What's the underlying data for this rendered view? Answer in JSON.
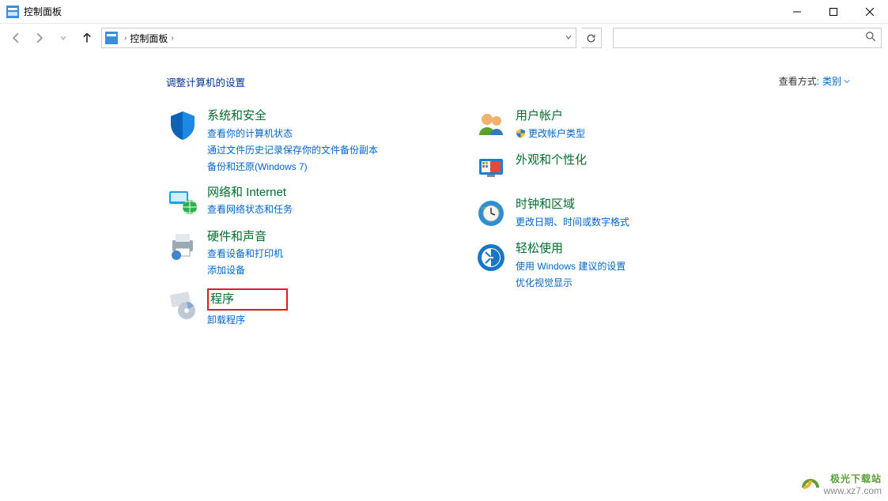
{
  "window": {
    "title": "控制面板"
  },
  "breadcrumb": {
    "root": "控制面板"
  },
  "heading": "调整计算机的设置",
  "viewBy": {
    "label": "查看方式:",
    "value": "类别"
  },
  "categories": {
    "systemSecurity": {
      "title": "系统和安全",
      "links": [
        "查看你的计算机状态",
        "通过文件历史记录保存你的文件备份副本",
        "备份和还原(Windows 7)"
      ]
    },
    "network": {
      "title": "网络和 Internet",
      "links": [
        "查看网络状态和任务"
      ]
    },
    "hardware": {
      "title": "硬件和声音",
      "links": [
        "查看设备和打印机",
        "添加设备"
      ]
    },
    "programs": {
      "title": "程序",
      "links": [
        "卸载程序"
      ]
    },
    "userAccounts": {
      "title": "用户帐户",
      "links": [
        "更改帐户类型"
      ]
    },
    "appearance": {
      "title": "外观和个性化"
    },
    "clock": {
      "title": "时钟和区域",
      "links": [
        "更改日期、时间或数字格式"
      ]
    },
    "ease": {
      "title": "轻松使用",
      "links": [
        "使用 Windows 建议的设置",
        "优化视觉显示"
      ]
    }
  },
  "watermark": {
    "line1": "极光下载站",
    "line2": "www.xz7.com"
  }
}
